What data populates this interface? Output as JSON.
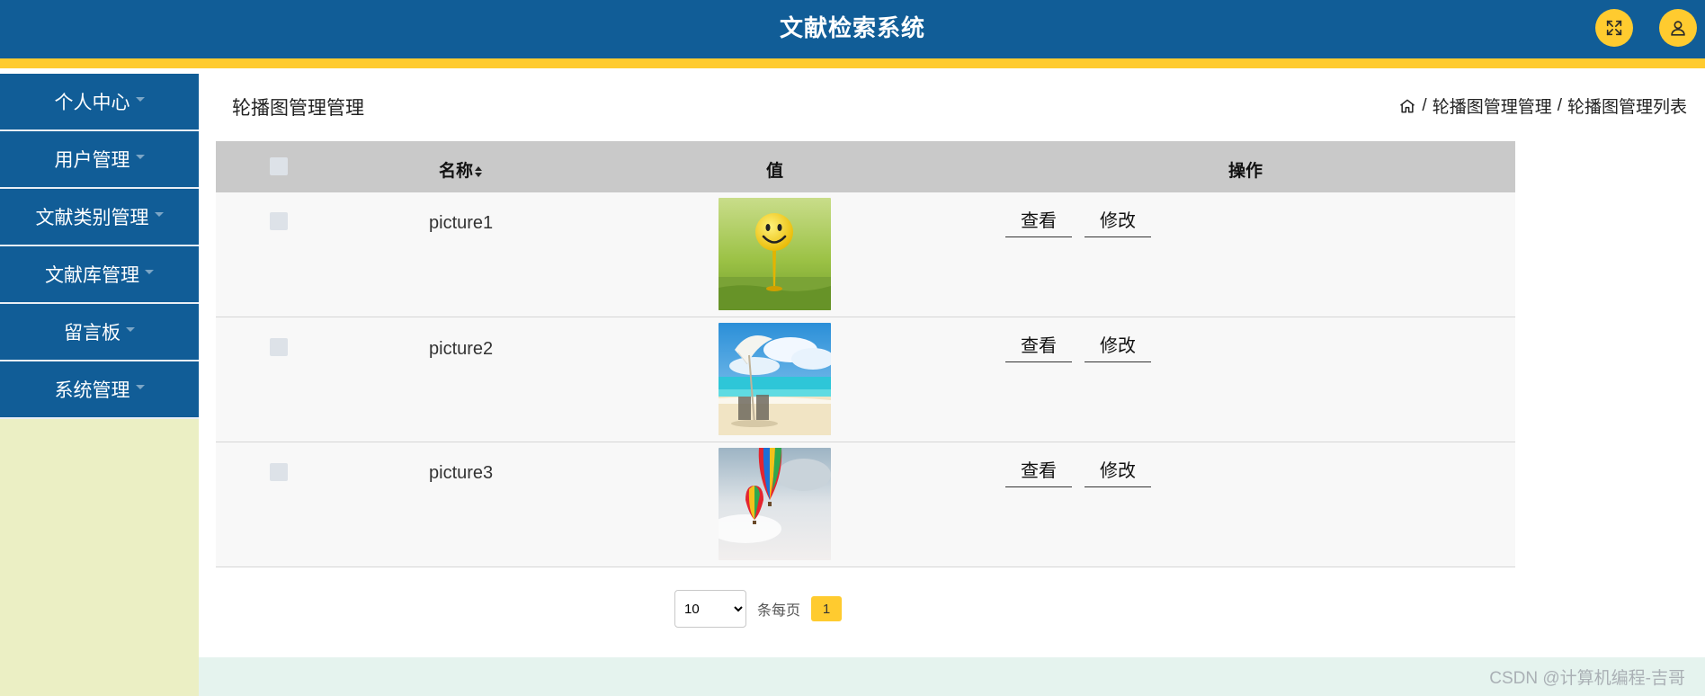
{
  "header": {
    "title": "文献检索系统",
    "colors": {
      "bar": "#115d97",
      "accent": "#ffcb2f"
    },
    "buttons": [
      {
        "name": "fullscreen",
        "icon": "fullscreen-icon"
      },
      {
        "name": "user",
        "icon": "user-icon"
      }
    ]
  },
  "sidebar": {
    "items": [
      {
        "label": "个人中心"
      },
      {
        "label": "用户管理"
      },
      {
        "label": "文献类别管理"
      },
      {
        "label": "文献库管理"
      },
      {
        "label": "留言板"
      },
      {
        "label": "系统管理"
      }
    ]
  },
  "main": {
    "page_title": "轮播图管理管理",
    "breadcrumb": {
      "sep": "/",
      "items": [
        "轮播图管理管理",
        "轮播图管理列表"
      ]
    },
    "table": {
      "headers": {
        "name": "名称",
        "value": "值",
        "ops": "操作"
      },
      "rows": [
        {
          "name": "picture1",
          "image": "smiley-golf-ball-image",
          "view": "查看",
          "edit": "修改"
        },
        {
          "name": "picture2",
          "image": "beach-umbrella-image",
          "view": "查看",
          "edit": "修改"
        },
        {
          "name": "picture3",
          "image": "hot-air-balloons-image",
          "view": "查看",
          "edit": "修改"
        }
      ]
    },
    "pagination": {
      "page_size": "10",
      "page_size_options": [
        "10"
      ],
      "per_page_label": "条每页",
      "current_page": "1"
    }
  },
  "footer": {
    "watermark": "CSDN @计算机编程-吉哥"
  }
}
